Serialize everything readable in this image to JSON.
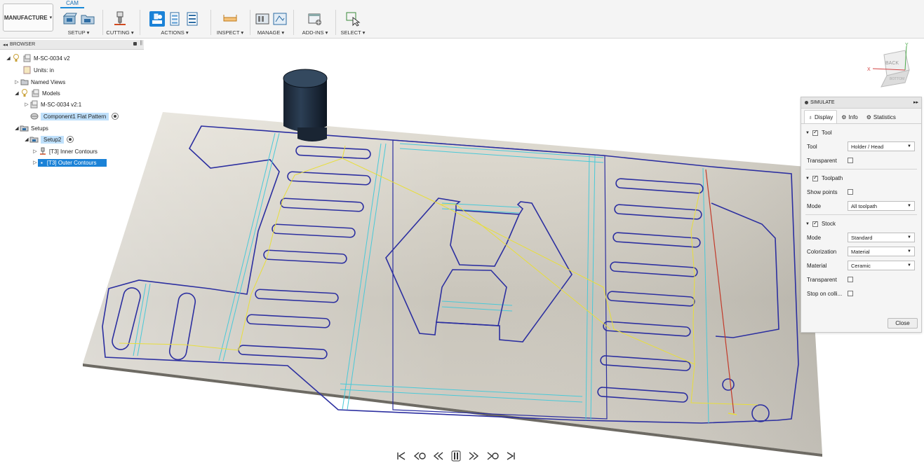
{
  "toolbar": {
    "workspace": "MANUFACTURE",
    "active_tab": "CAM",
    "groups": [
      {
        "label": "SETUP ▾"
      },
      {
        "label": "CUTTING ▾"
      },
      {
        "label": "ACTIONS ▾"
      },
      {
        "label": "INSPECT ▾"
      },
      {
        "label": "MANAGE ▾"
      },
      {
        "label": "ADD-INS ▾"
      },
      {
        "label": "SELECT ▾"
      }
    ]
  },
  "browser": {
    "title": "BROWSER",
    "items": [
      {
        "label": "M-SC-0034 v2"
      },
      {
        "label": "Units: in"
      },
      {
        "label": "Named Views"
      },
      {
        "label": "Models"
      },
      {
        "label": "M-SC-0034 v2:1"
      },
      {
        "label": "Component1 Flat Pattern"
      },
      {
        "label": "Setups"
      },
      {
        "label": "Setup2"
      },
      {
        "label": "[T3] Inner Contours"
      },
      {
        "label": "[T3] Outer Contours"
      }
    ]
  },
  "viewcube": {
    "face_top": "BACK",
    "face_bottom": "BOTTOM",
    "axis_x": "X",
    "axis_y": "Y"
  },
  "simulate": {
    "title": "SIMULATE",
    "tabs": [
      {
        "label": "Display"
      },
      {
        "label": "Info"
      },
      {
        "label": "Statistics"
      }
    ],
    "tool_section": "Tool",
    "tool_label": "Tool",
    "tool_value": "Holder / Head",
    "tool_transparent": "Transparent",
    "toolpath_section": "Toolpath",
    "show_points": "Show points",
    "tp_mode_label": "Mode",
    "tp_mode_value": "All toolpath",
    "stock_section": "Stock",
    "stock_mode_label": "Mode",
    "stock_mode_value": "Standard",
    "colorization_label": "Colorization",
    "colorization_value": "Material",
    "material_label": "Material",
    "material_value": "Ceramic",
    "stock_transparent": "Transparent",
    "stop_on_collision": "Stop on colli...",
    "close": "Close"
  },
  "playback": [
    "skip-to-start",
    "previous-operation",
    "step-back",
    "play-pause",
    "step-forward",
    "next-operation",
    "skip-to-end"
  ]
}
